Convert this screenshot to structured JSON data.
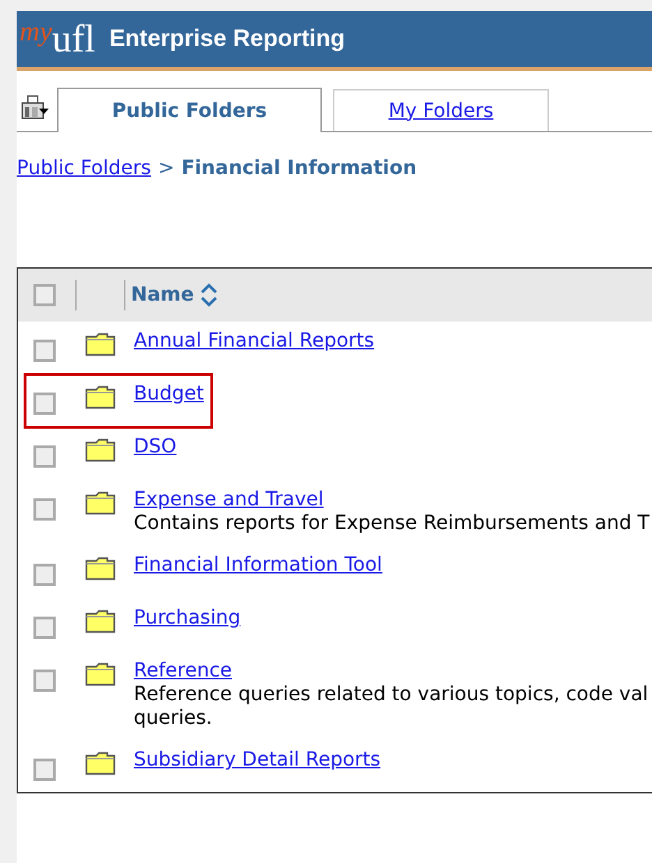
{
  "header": {
    "logo_prefix": "my",
    "logo_main": "ufl",
    "title": "Enterprise Reporting"
  },
  "tabs": [
    {
      "label": "Public Folders",
      "selected": true
    },
    {
      "label": "My Folders",
      "selected": false
    }
  ],
  "breadcrumb": {
    "link": "Public Folders",
    "separator": ">",
    "current": "Financial Information"
  },
  "table": {
    "select_all": {
      "checked": false
    },
    "column": "Name",
    "rows": [
      {
        "name": "Annual Financial Reports",
        "checked": false,
        "highlighted": false
      },
      {
        "name": "Budget",
        "checked": false,
        "highlighted": true
      },
      {
        "name": "DSO",
        "checked": false,
        "highlighted": false
      },
      {
        "name": "Expense and Travel",
        "checked": false,
        "highlighted": false,
        "description": [
          "Contains reports for Expense Reimbursements and T"
        ]
      },
      {
        "name": "Financial Information Tool",
        "checked": false,
        "highlighted": false
      },
      {
        "name": "Purchasing",
        "checked": false,
        "highlighted": false
      },
      {
        "name": "Reference",
        "checked": false,
        "highlighted": false,
        "description": [
          "Reference queries related to various topics, code val",
          "queries."
        ]
      },
      {
        "name": "Subsidiary Detail Reports",
        "checked": false,
        "highlighted": false
      }
    ]
  }
}
